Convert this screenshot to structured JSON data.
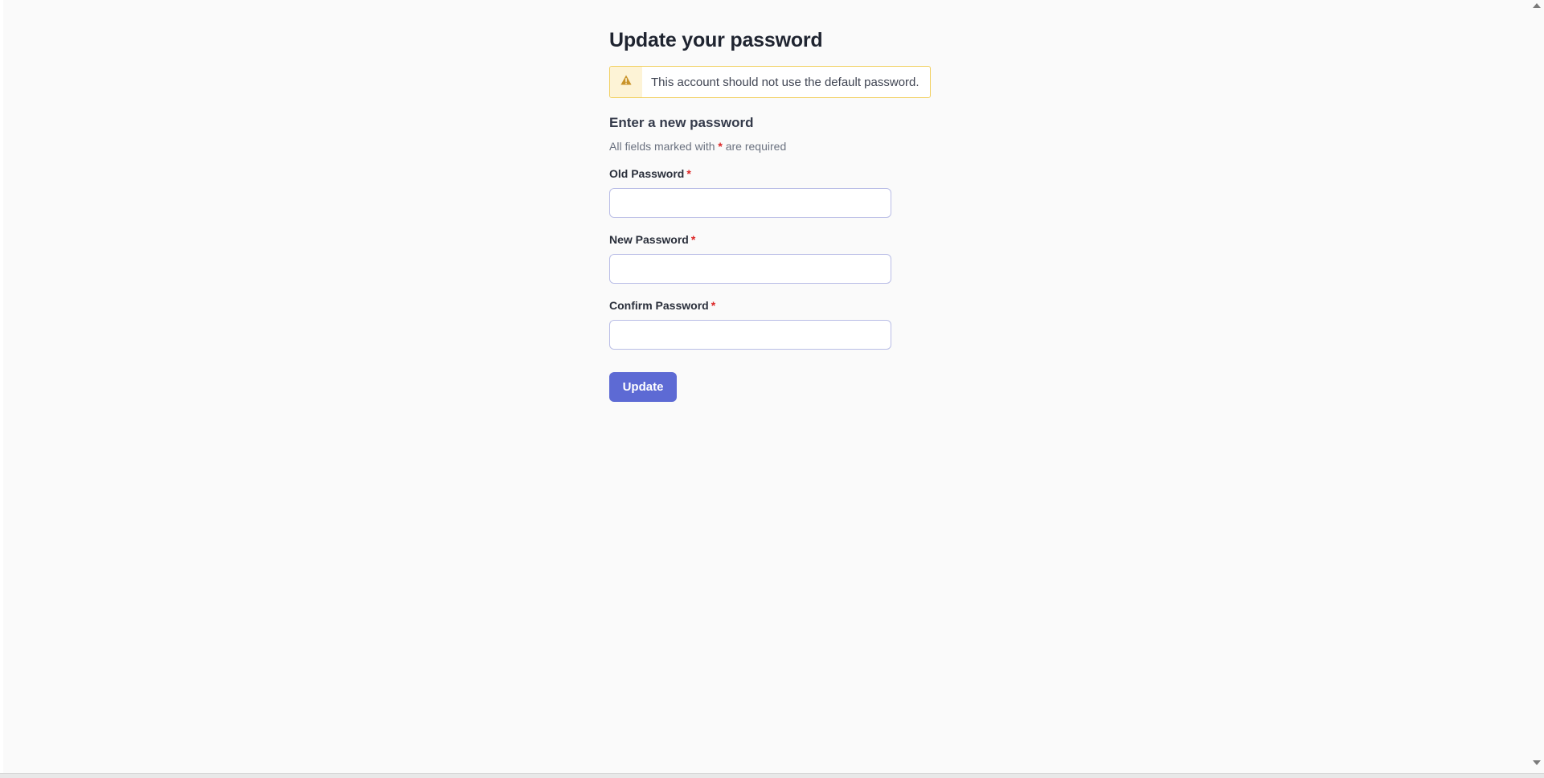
{
  "page": {
    "title": "Update your password"
  },
  "alert": {
    "icon": "warning-triangle-icon",
    "message": "This account should not use the default password.",
    "icon_color": "#c9932a",
    "border_color": "#f1cf5f"
  },
  "form": {
    "section_title": "Enter a new password",
    "hint_before": "All fields marked with",
    "required_marker": "*",
    "hint_after": "are required",
    "fields": [
      {
        "label": "Old Password",
        "value": "",
        "placeholder": ""
      },
      {
        "label": "New Password",
        "value": "",
        "placeholder": ""
      },
      {
        "label": "Confirm Password",
        "value": "",
        "placeholder": ""
      }
    ],
    "submit_label": "Update"
  },
  "colors": {
    "primary": "#5d6ad4",
    "required": "#dc2626",
    "background": "#fafafa"
  }
}
